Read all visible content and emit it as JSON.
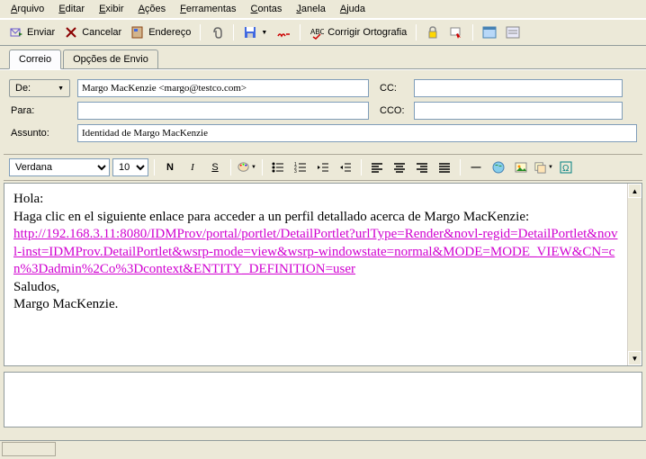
{
  "menu": {
    "items": [
      "Arquivo",
      "Editar",
      "Exibir",
      "Ações",
      "Ferramentas",
      "Contas",
      "Janela",
      "Ajuda"
    ]
  },
  "toolbar": {
    "send": "Enviar",
    "cancel": "Cancelar",
    "address": "Endereço",
    "spell": "Corrigir Ortografia"
  },
  "tabs": {
    "mail": "Correio",
    "sendopts": "Opções de Envio"
  },
  "header": {
    "from_label": "De:",
    "from_value": "Margo MacKenzie <margo@testco.com>",
    "to_label": "Para:",
    "to_value": "",
    "subject_label": "Assunto:",
    "subject_value": "Identidad de Margo MacKenzie",
    "cc_label": "CC:",
    "cc_value": "",
    "bcc_label": "CCO:",
    "bcc_value": ""
  },
  "format": {
    "font": "Verdana",
    "size": "10"
  },
  "body": {
    "greeting": "Hola:",
    "intro": "Haga clic en el siguiente enlace para acceder a un perfil detallado acerca de Margo MacKenzie:",
    "link": "http://192.168.3.11:8080/IDMProv/portal/portlet/DetailPortlet?urlType=Render&novl-regid=DetailPortlet&novl-inst=IDMProv.DetailPortlet&wsrp-mode=view&wsrp-windowstate=normal&MODE=MODE_VIEW&CN=cn%3Dadmin%2Co%3Dcontext&ENTITY_DEFINITION=user",
    "closing": "Saludos,",
    "signature": "Margo MacKenzie."
  }
}
